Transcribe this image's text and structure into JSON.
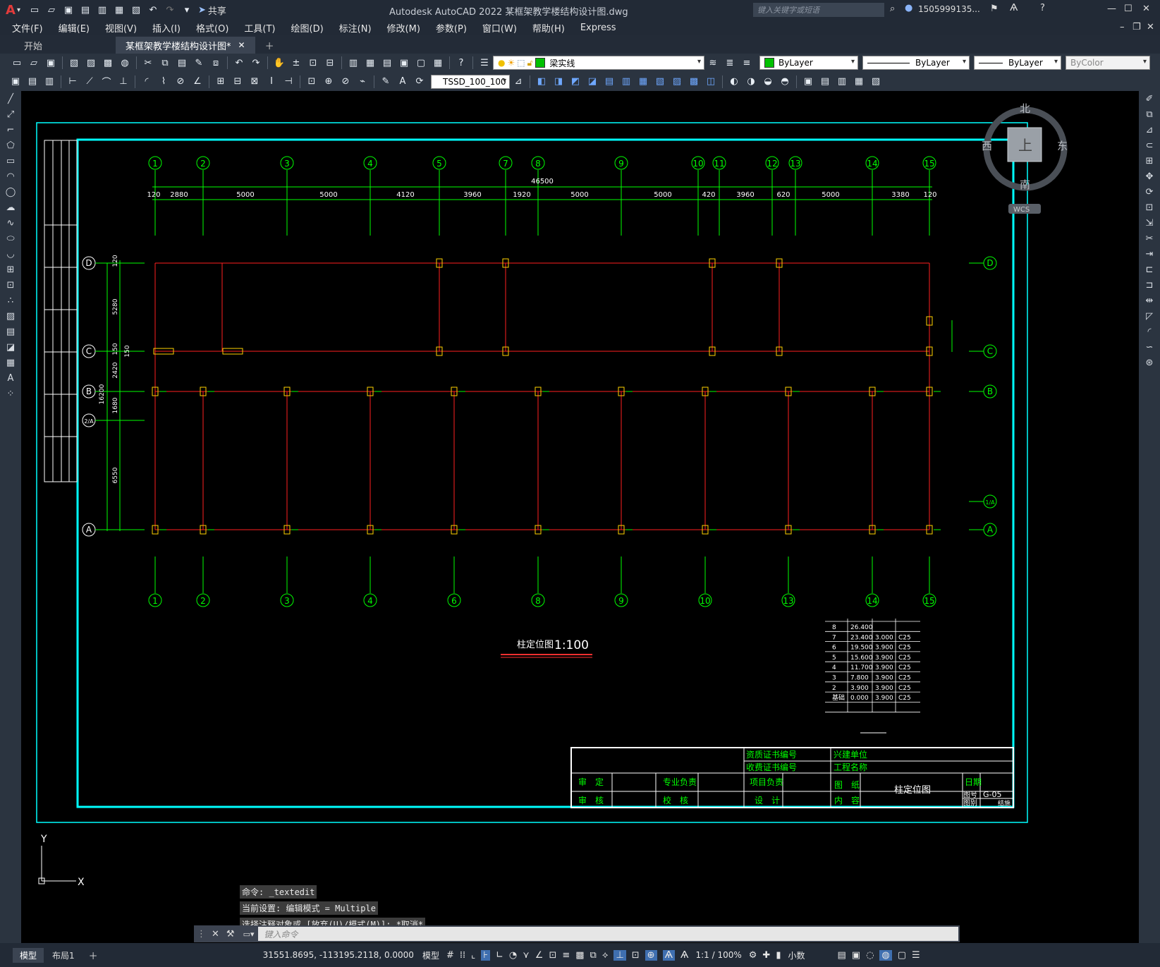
{
  "title": {
    "app_menu_glyph": "A",
    "text": "Autodesk AutoCAD 2022    某框架教学楼结构设计图.dwg",
    "share_label": "共享",
    "search_placeholder": "键入关键字或短语",
    "user": "1505999135...",
    "window_controls": [
      "—",
      "☐",
      "✕"
    ]
  },
  "menu": [
    "文件(F)",
    "编辑(E)",
    "视图(V)",
    "插入(I)",
    "格式(O)",
    "工具(T)",
    "绘图(D)",
    "标注(N)",
    "修改(M)",
    "参数(P)",
    "窗口(W)",
    "帮助(H)",
    "Express"
  ],
  "tabs": [
    {
      "label": "开始"
    },
    {
      "label": "某框架教学楼结构设计图*"
    }
  ],
  "toolbar": {
    "layer_name": "梁实线",
    "color": "ByLayer",
    "linetype": "ByLayer",
    "lineweight": "ByLayer",
    "plotstyle": "ByColor",
    "dimstyle": "TSSD_100_100"
  },
  "viewcube": {
    "north": "北",
    "south": "南",
    "east": "东",
    "west": "西",
    "top": "上",
    "wcs": "WCS"
  },
  "drawing": {
    "axes_top": [
      "1",
      "2",
      "3",
      "4",
      "5",
      "7",
      "8",
      "9",
      "10",
      "11",
      "12",
      "13",
      "14",
      "15"
    ],
    "axes_bottom": [
      "1",
      "2",
      "3",
      "4",
      "6",
      "8",
      "9",
      "10",
      "13",
      "14",
      "15"
    ],
    "rows": [
      "D",
      "C",
      "B",
      "2/A",
      "A"
    ],
    "right_rows": [
      "D",
      "C",
      "B",
      "1/A",
      "A"
    ],
    "total_dim": "46500",
    "segment_dims": [
      "120",
      "2880",
      "5000",
      "5000",
      "4120",
      "3960",
      "1920",
      "5000",
      "5000",
      "420",
      "3960",
      "620",
      "5000",
      "3380",
      "120"
    ],
    "left_dims": [
      "120",
      "5280",
      "150",
      "2420",
      "150",
      "1680",
      "6550",
      "16200"
    ],
    "plan_title": "柱定位图",
    "plan_scale": "1:100",
    "level_table": [
      [
        "8",
        "26.400",
        "",
        ""
      ],
      [
        "7",
        "23.400",
        "3.000",
        "C25"
      ],
      [
        "6",
        "19.500",
        "3.900",
        "C25"
      ],
      [
        "5",
        "15.600",
        "3.900",
        "C25"
      ],
      [
        "4",
        "11.700",
        "3.900",
        "C25"
      ],
      [
        "3",
        "7.800",
        "3.900",
        "C25"
      ],
      [
        "2",
        "3.900",
        "3.900",
        "C25"
      ],
      [
        "基础",
        "0.000",
        "3.900",
        "C25"
      ]
    ],
    "titleblock": {
      "cert1": "资质证书编号",
      "cert2": "收费证书编号",
      "unit": "兴建单位",
      "project": "工程名称",
      "approve": "审　定",
      "check": "审　核",
      "major": "专业负责",
      "proofread": "校　核",
      "proj_lead": "项目负责",
      "design": "设　计",
      "drawing": "图　纸",
      "content": "内　容",
      "drawing_name": "柱定位图",
      "date": "日期",
      "sheet_no": "图号",
      "sheet_cat": "图别",
      "sheet_val": "G-05",
      "cat_val": "结施"
    }
  },
  "ucs": {
    "y": "Y",
    "x": "X"
  },
  "command": {
    "history": [
      "命令: _textedit",
      "当前设置: 编辑模式 = Multiple",
      "选择注释对象或 [放弃(U)/模式(M)]: *取消*"
    ],
    "placeholder": "键入命令"
  },
  "status": {
    "layout_tabs": [
      "模型",
      "布局1"
    ],
    "coords": "31551.8695, -113195.2118, 0.0000",
    "mode": "模型",
    "scale": "1:1 / 100%",
    "units": "小数"
  }
}
